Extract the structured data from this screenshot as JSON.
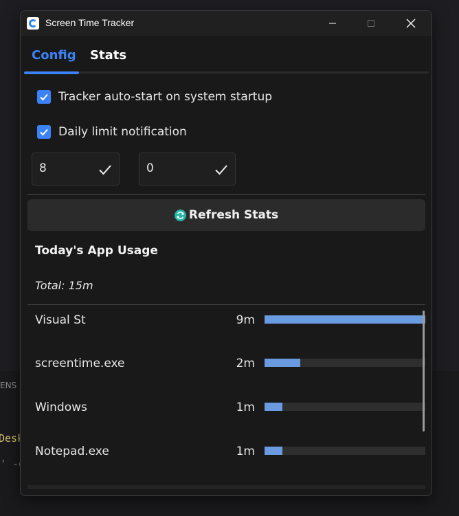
{
  "background": {
    "ens_text": "ENS",
    "desk_text": "Desk",
    "opt_text": "' -o"
  },
  "window": {
    "title": "Screen Time Tracker",
    "controls": [
      "minimize",
      "maximize",
      "close"
    ]
  },
  "tabs": [
    {
      "label": "Config",
      "active": true
    },
    {
      "label": "Stats",
      "active": false
    }
  ],
  "config": {
    "autostart_label": "Tracker auto-start on system startup",
    "autostart_checked": true,
    "daily_limit_label": "Daily limit notification",
    "daily_limit_checked": true,
    "hours_value": "8",
    "minutes_value": "0"
  },
  "refresh_button_label": "Refresh Stats",
  "usage": {
    "section_title": "Today's App Usage",
    "total_label": "Total: 15m",
    "items": [
      {
        "name": "Visual St",
        "time": "9m",
        "fraction": 1.0
      },
      {
        "name": "screentime.exe",
        "time": "2m",
        "fraction": 0.222
      },
      {
        "name": "Windows",
        "time": "1m",
        "fraction": 0.111
      },
      {
        "name": "Notepad.exe",
        "time": "1m",
        "fraction": 0.111
      }
    ]
  },
  "colors": {
    "accent": "#3b82f6",
    "bar_fill": "#6a9be0",
    "bar_track": "#2e2e2e",
    "refresh_icon": "#26b5a8"
  },
  "icons": {
    "app": "app-logo-icon",
    "confirm": "checkmark-icon",
    "refresh": "refresh-icon"
  }
}
